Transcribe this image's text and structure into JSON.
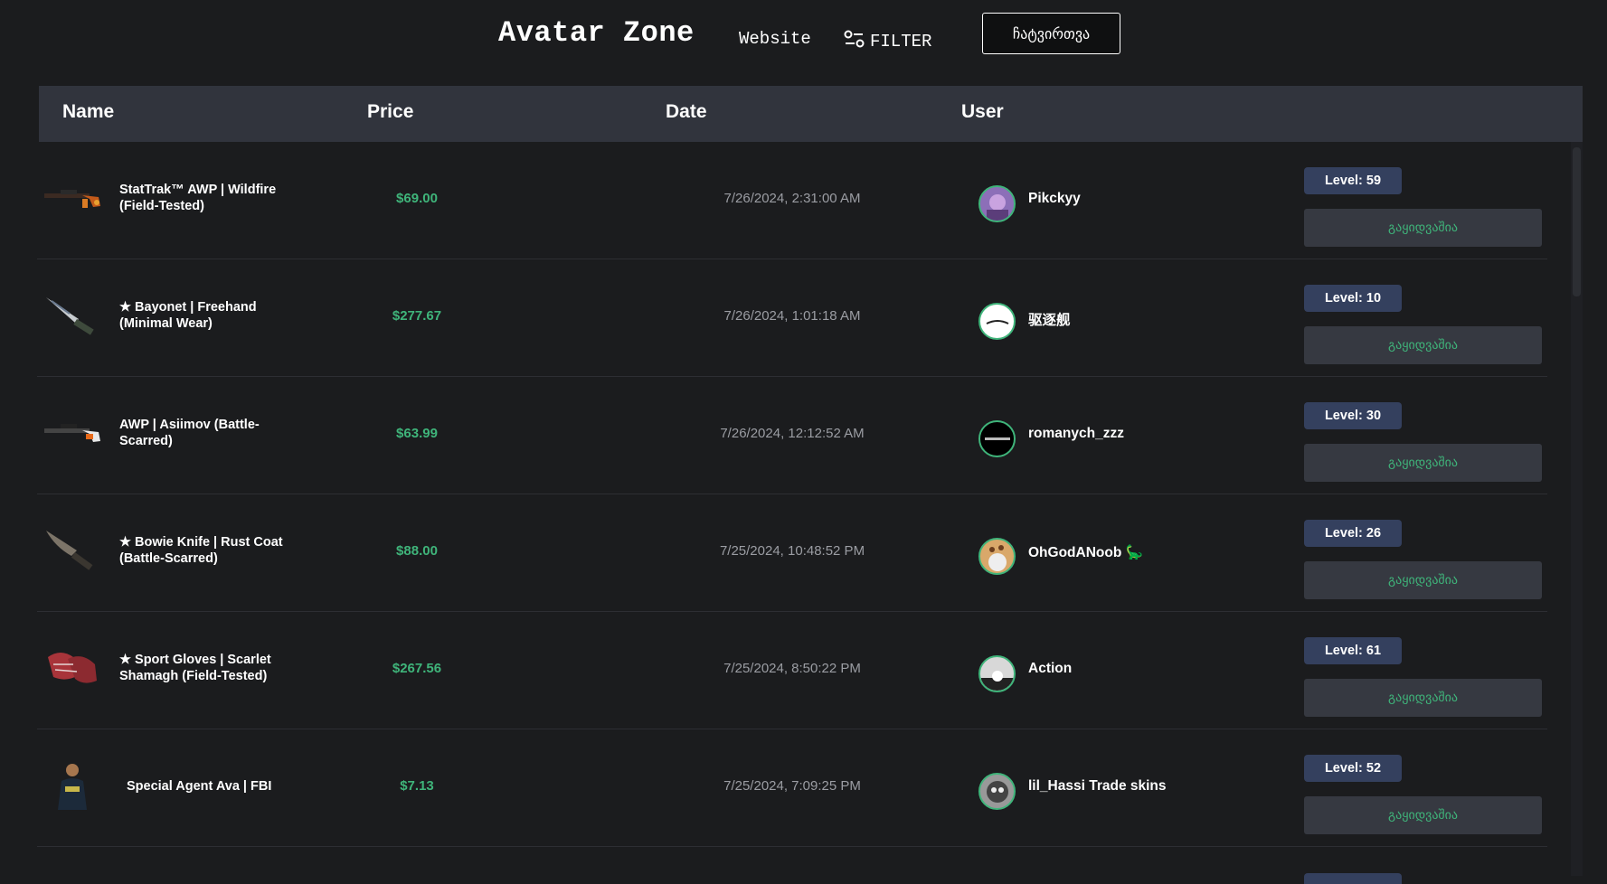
{
  "header": {
    "brand": "Avatar Zone",
    "website_label": "Website",
    "filter_label": "FILTER",
    "login_label": "ჩატვირთვა"
  },
  "table": {
    "columns": [
      "Name",
      "Price",
      "Date",
      "User"
    ],
    "buy_label": "გაყიდვაშია",
    "rows": [
      {
        "icon": "awp-rifle-icon",
        "name": "StatTrak™ AWP | Wildfire (Field-Tested)",
        "price": "$69.00",
        "date": "7/26/2024, 2:31:00 AM",
        "user": "Pikckyy",
        "level": "Level: 59"
      },
      {
        "icon": "bayonet-knife-icon",
        "name": "★ Bayonet | Freehand (Minimal Wear)",
        "price": "$277.67",
        "date": "7/26/2024, 1:01:18 AM",
        "user": "驱逐舰",
        "level": "Level: 10"
      },
      {
        "icon": "awp-rifle-icon",
        "name": "AWP | Asiimov (Battle-Scarred)",
        "price": "$63.99",
        "date": "7/26/2024, 12:12:52 AM",
        "user": "romanych_zzz",
        "level": "Level: 30"
      },
      {
        "icon": "bowie-knife-icon",
        "name": "★ Bowie Knife | Rust Coat (Battle-Scarred)",
        "price": "$88.00",
        "date": "7/25/2024, 10:48:52 PM",
        "user": "OhGodANoob 🦕",
        "level": "Level: 26"
      },
      {
        "icon": "gloves-icon",
        "name": "★ Sport Gloves | Scarlet Shamagh (Field-Tested)",
        "price": "$267.56",
        "date": "7/25/2024, 8:50:22 PM",
        "user": "Action",
        "level": "Level: 61"
      },
      {
        "icon": "agent-icon",
        "name": "Special Agent Ava | FBI",
        "price": "$7.13",
        "date": "7/25/2024, 7:09:25 PM",
        "user": "lil_Hassi Trade skins",
        "level": "Level: 52"
      }
    ]
  },
  "colors": {
    "background": "#1b1c1e",
    "header_row": "#31343d",
    "accent_green": "#3fb47a",
    "level_badge": "#34405e",
    "button": "#363941"
  }
}
